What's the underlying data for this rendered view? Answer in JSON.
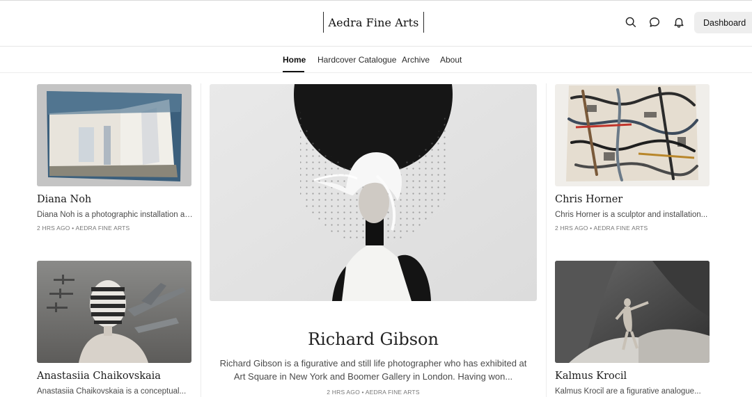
{
  "header": {
    "brand": "Aedra Fine Arts",
    "icons": [
      "search-icon",
      "chat-bubble-icon",
      "bell-icon"
    ],
    "dashboard_label": "Dashboard"
  },
  "nav": {
    "items": [
      {
        "label": "Home",
        "active": true
      },
      {
        "label": "Hardcover Catalogue",
        "active": false
      },
      {
        "label": "Archive",
        "active": false
      },
      {
        "label": "About",
        "active": false
      }
    ]
  },
  "posts": {
    "left_top": {
      "title": "Diana Noh",
      "excerpt": "Diana Noh is a photographic installation arti...",
      "meta": "2 HRS AGO • AEDRA FINE ARTS"
    },
    "left_bottom": {
      "title": "Anastasiia Chaikovskaia",
      "excerpt": "Anastasiia Chaikovskaia is a conceptual..."
    },
    "featured": {
      "title": "Richard Gibson",
      "excerpt": "Richard Gibson is a figurative and still life photographer who has exhibited at Art Square in New York and Boomer Gallery in London. Having won...",
      "meta": "2 HRS AGO • AEDRA FINE ARTS"
    },
    "right_top": {
      "title": "Chris Horner",
      "excerpt": "Chris Horner is a sculptor and installation...",
      "meta": "2 HRS AGO • AEDRA FINE ARTS"
    },
    "right_bottom": {
      "title": "Kalmus Krocil",
      "excerpt": "Kalmus Krocil are a figurative analogue..."
    }
  },
  "colors": {
    "accent": "#111111",
    "button_bg": "#eeeeee",
    "divider": "#ececec"
  }
}
